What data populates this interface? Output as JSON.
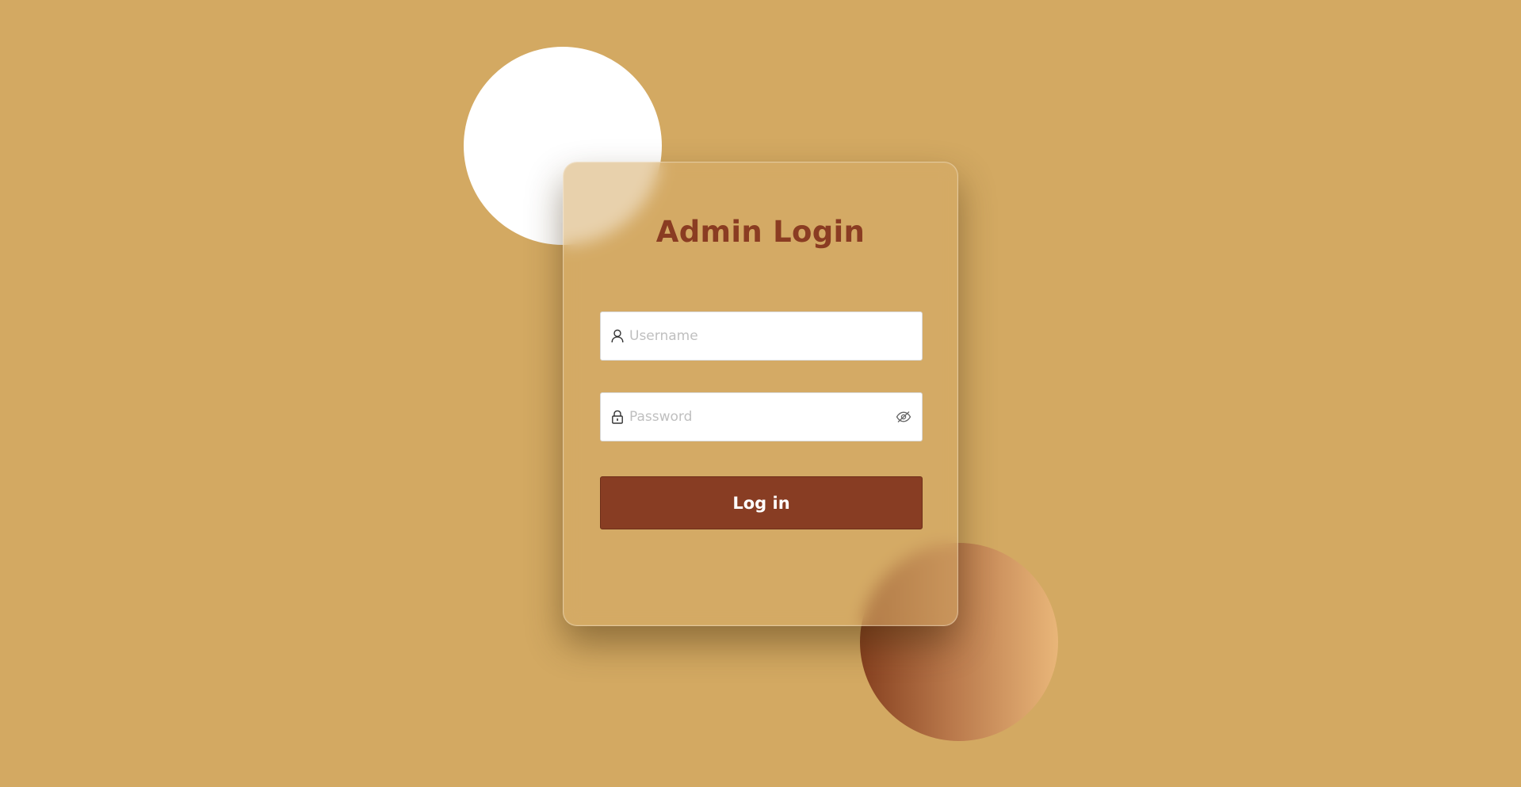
{
  "background_color": "#d3a962",
  "accent_color": "#883d23",
  "title_color": "#8a3c22",
  "login_card": {
    "title": "Admin Login",
    "username": {
      "placeholder": "Username",
      "value": "",
      "icon": "user-icon"
    },
    "password": {
      "placeholder": "Password",
      "value": "",
      "icon": "lock-icon",
      "toggle_icon": "eye-off-icon"
    },
    "login_button_label": "Log in"
  }
}
